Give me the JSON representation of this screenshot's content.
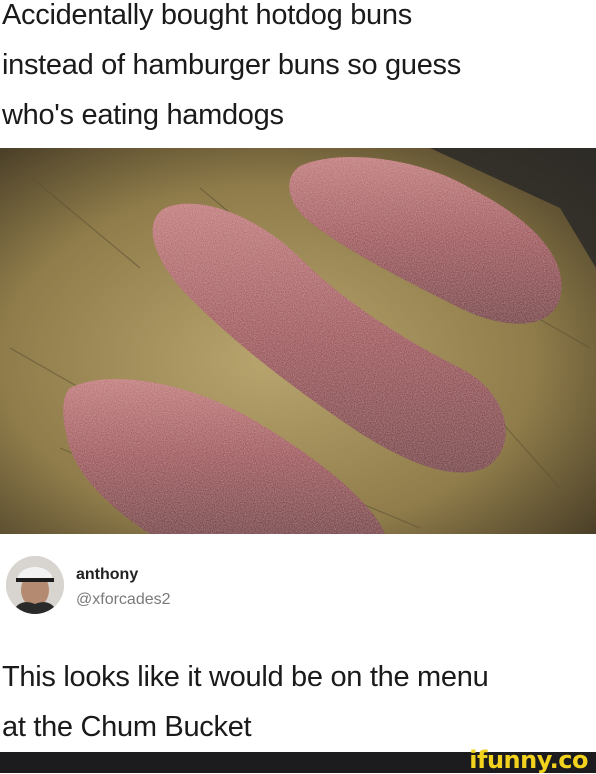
{
  "post": {
    "text_line_1": "Accidentally bought hotdog buns",
    "text_line_2": "instead of hamburger buns so guess",
    "text_line_3": "who's eating hamdogs"
  },
  "photo": {
    "subject": "hamdogs-on-baking-tray",
    "colors": {
      "tray": "#a8935e",
      "meat": "#9a4a4c"
    }
  },
  "reply": {
    "name": "anthony",
    "handle": "@xforcades2",
    "text_line_1": "This looks like it would be on the menu",
    "text_line_2": "at the Chum Bucket"
  },
  "footer": {
    "watermark": "ifunny.co",
    "colors": {
      "bar": "#1c1c1e",
      "watermark": "#f3d21e"
    }
  }
}
